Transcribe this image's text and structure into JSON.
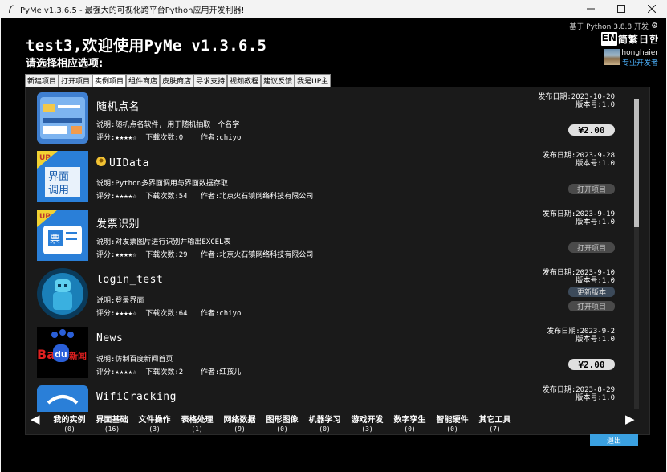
{
  "window": {
    "title": "PyMe v1.3.6.5 - 最强大的可视化跨平台Python应用开发利器!"
  },
  "header": {
    "greeting": "test3,欢迎使用PyMe v1.3.6.5",
    "prompt": "请选择相应选项:",
    "python_version": "基于 Python 3.8.8 开发",
    "languages": [
      "EN",
      "简",
      "繁",
      "日",
      "한"
    ],
    "user_name": "honghaier",
    "user_role": "专业开发者"
  },
  "tabs": [
    "新建项目",
    "打开项目",
    "实例项目",
    "组件商店",
    "皮肤商店",
    "寻求支持",
    "视频教程",
    "建议反馈",
    "我是UP主"
  ],
  "items": [
    {
      "name": "随机点名",
      "desc": "说明:随机点名软件, 用于随机抽取一个名字",
      "meta": "评分:★★★★☆  下载次数:0    作者:chiyo",
      "date": "发布日期:2023-10-20",
      "version": "版本号:1.0",
      "price": "¥2.00"
    },
    {
      "name": "UIData",
      "desc": "说明:Python多界面调用与界面数据存取",
      "meta": "评分:★★★★☆  下载次数:54   作者:北京火石镇网络科技有限公司",
      "date": "发布日期:2023-9-28",
      "version": "版本号:1.0",
      "open": "打开项目"
    },
    {
      "name": "发票识别",
      "desc": "说明:对发票图片进行识别并输出EXCEL表",
      "meta": "评分:★★★★☆  下载次数:29   作者:北京火石镇网络科技有限公司",
      "date": "发布日期:2023-9-19",
      "version": "版本号:1.0",
      "open": "打开项目"
    },
    {
      "name": "login_test",
      "desc": "说明:登录界面",
      "meta": "评分:★★★★☆  下载次数:64   作者:chiyo",
      "date": "发布日期:2023-9-10",
      "version": "版本号:1.0",
      "update": "更新版本",
      "open": "打开项目"
    },
    {
      "name": "News",
      "desc": "说明:仿制百度新闻首页",
      "meta": "评分:★★★★☆  下载次数:2    作者:红孩儿",
      "date": "发布日期:2023-9-2",
      "version": "版本号:1.0",
      "price": "¥2.00"
    },
    {
      "name": "WifiCracking",
      "date": "发布日期:2023-8-29",
      "version": "版本号:1.0"
    }
  ],
  "thumb_text": {
    "badge": "UP",
    "ui_line1": "界面",
    "ui_line2": "调用",
    "invoice": "票",
    "baidu_bai": "Bai",
    "baidu_du": "du",
    "baidu_news": "新闻"
  },
  "categories": [
    {
      "label": "我的实例",
      "count": "(0)"
    },
    {
      "label": "界面基础",
      "count": "(16)"
    },
    {
      "label": "文件操作",
      "count": "(3)"
    },
    {
      "label": "表格处理",
      "count": "(1)"
    },
    {
      "label": "网络数据",
      "count": "(9)"
    },
    {
      "label": "图形图像",
      "count": "(0)"
    },
    {
      "label": "机器学习",
      "count": "(0)"
    },
    {
      "label": "游戏开发",
      "count": "(3)"
    },
    {
      "label": "数字孪生",
      "count": "(0)"
    },
    {
      "label": "智能硬件",
      "count": "(0)"
    },
    {
      "label": "其它工具",
      "count": "(7)"
    }
  ],
  "nav": {
    "prev": "◀",
    "next": "▶"
  },
  "exit_label": "退出",
  "colors": {
    "accent": "#3aa0e0",
    "role": "#4db3ff",
    "background": "#000000",
    "panel": "#1a1a1a"
  }
}
